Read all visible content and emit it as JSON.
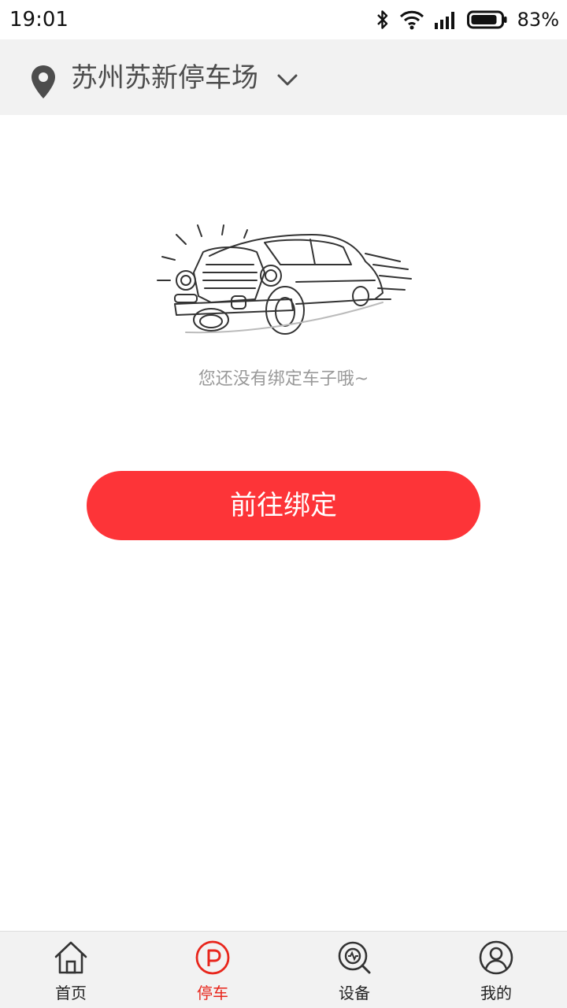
{
  "status_bar": {
    "time": "19:01",
    "battery": "83%",
    "icons": [
      "bluetooth-icon",
      "wifi-icon",
      "signal-icon",
      "battery-icon"
    ]
  },
  "header": {
    "location_name": "苏州苏新停车场",
    "icons": [
      "location-pin-icon",
      "chevron-down-icon"
    ]
  },
  "empty_state": {
    "illustration": "car-illustration",
    "message": "您还没有绑定车子哦~"
  },
  "bind_button": {
    "label": "前往绑定"
  },
  "tabs": [
    {
      "label": "首页",
      "icon": "home-icon",
      "active": false
    },
    {
      "label": "停车",
      "icon": "parking-icon",
      "active": true
    },
    {
      "label": "设备",
      "icon": "device-search-icon",
      "active": false
    },
    {
      "label": "我的",
      "icon": "user-icon",
      "active": false
    }
  ],
  "colors": {
    "accent": "#fd3438",
    "active_tab": "#e8261c",
    "header_bg": "#f2f2f2"
  }
}
